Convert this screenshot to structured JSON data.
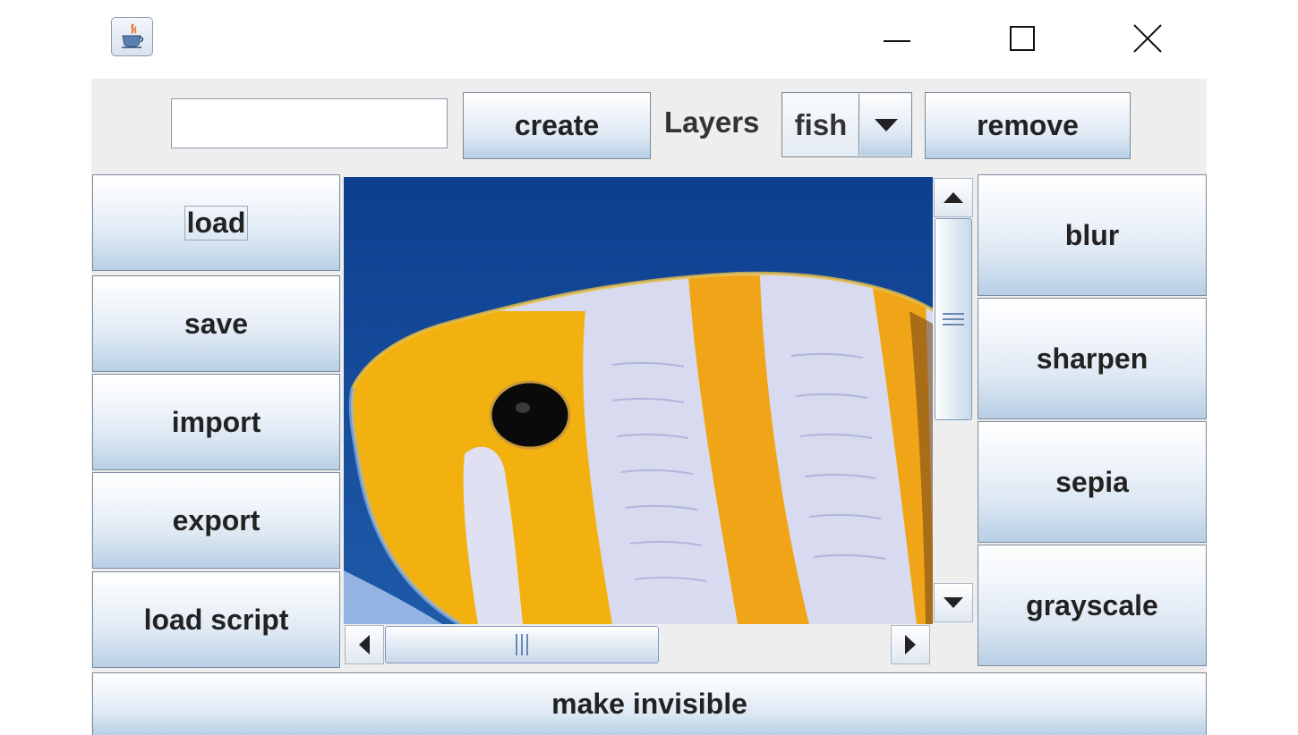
{
  "window": {
    "app_icon": "java-coffee-cup-icon",
    "controls": [
      "minimize-icon",
      "maximize-icon",
      "close-icon"
    ]
  },
  "toolbar": {
    "layer_name_value": "",
    "create_label": "create",
    "layers_label": "Layers",
    "selected_layer": "fish",
    "remove_label": "remove"
  },
  "left_actions": [
    "load",
    "save",
    "import",
    "export",
    "load script"
  ],
  "right_filters": [
    "blur",
    "sharpen",
    "sepia",
    "grayscale"
  ],
  "bottom": {
    "visibility_label": "make invisible"
  },
  "colors": {
    "panel_bg": "#eeeeee",
    "button_gradient_bottom": "#b8cfe5",
    "ocean_blue": "#1a4e9a",
    "fish_yellow": "#f2b10e",
    "fish_stripe_white": "#d9dcf0"
  }
}
